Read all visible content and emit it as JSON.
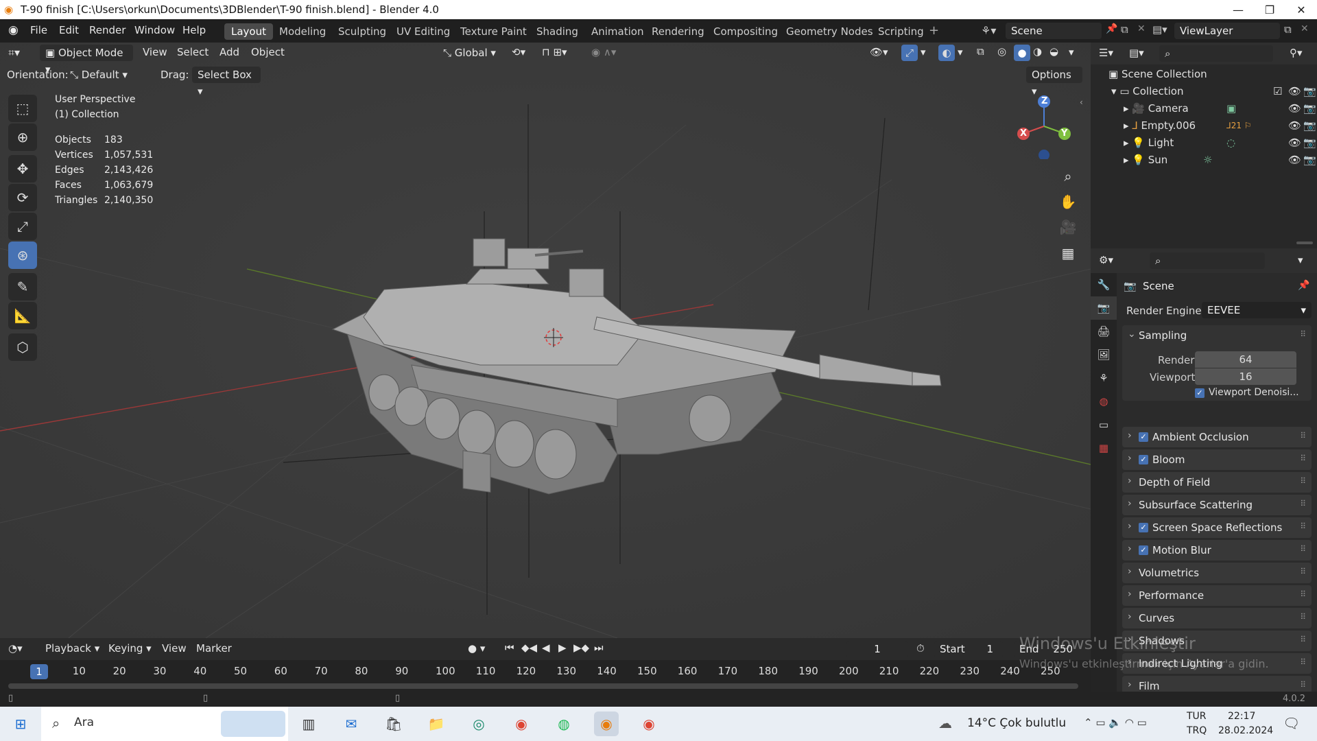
{
  "window": {
    "title": "T-90 finish [C:\\Users\\orkun\\Documents\\3DBlender\\T-90 finish.blend] - Blender 4.0",
    "minimize": "—",
    "maximize": "❐",
    "close": "✕"
  },
  "menu": {
    "items": [
      "File",
      "Edit",
      "Render",
      "Window",
      "Help"
    ],
    "workspaces": [
      "Layout",
      "Modeling",
      "Sculpting",
      "UV Editing",
      "Texture Paint",
      "Shading",
      "Animation",
      "Rendering",
      "Compositing",
      "Geometry Nodes",
      "Scripting"
    ],
    "active_workspace": "Layout",
    "add_workspace": "+",
    "scene": "Scene",
    "view_layer": "ViewLayer"
  },
  "viewport": {
    "mode": "Object Mode",
    "menus": [
      "View",
      "Select",
      "Add",
      "Object"
    ],
    "transform_orientation": "Global",
    "orientation_label": "Orientation:",
    "orientation_value": "Default",
    "drag_label": "Drag:",
    "drag_value": "Select Box",
    "options": "Options",
    "perspective": "User Perspective",
    "collection": "(1) Collection",
    "stats": [
      {
        "label": "Objects",
        "value": "183"
      },
      {
        "label": "Vertices",
        "value": "1,057,531"
      },
      {
        "label": "Edges",
        "value": "2,143,426"
      },
      {
        "label": "Faces",
        "value": "1,063,679"
      },
      {
        "label": "Triangles",
        "value": "2,140,350"
      }
    ],
    "gizmo": {
      "x": "X",
      "y": "Y",
      "z": "Z"
    }
  },
  "outliner": {
    "root": "Scene Collection",
    "collection": "Collection",
    "items": [
      {
        "name": "Camera"
      },
      {
        "name": "Empty.006",
        "badge": "21"
      },
      {
        "name": "Light"
      },
      {
        "name": "Sun"
      }
    ]
  },
  "properties": {
    "context": "Scene",
    "render_engine_label": "Render Engine",
    "render_engine": "EEVEE",
    "sampling": {
      "title": "Sampling",
      "render_label": "Render",
      "render_value": "64",
      "viewport_label": "Viewport",
      "viewport_value": "16",
      "denoise": "Viewport Denoisi..."
    },
    "panels": [
      {
        "label": "Ambient Occlusion",
        "checkbox": true
      },
      {
        "label": "Bloom",
        "checkbox": true
      },
      {
        "label": "Depth of Field",
        "checkbox": false
      },
      {
        "label": "Subsurface Scattering",
        "checkbox": false
      },
      {
        "label": "Screen Space Reflections",
        "checkbox": true
      },
      {
        "label": "Motion Blur",
        "checkbox": true
      },
      {
        "label": "Volumetrics",
        "checkbox": false
      },
      {
        "label": "Performance",
        "checkbox": false
      },
      {
        "label": "Curves",
        "checkbox": false
      },
      {
        "label": "Shadows",
        "checkbox": false
      },
      {
        "label": "Indirect Lighting",
        "checkbox": false
      },
      {
        "label": "Film",
        "checkbox": false
      }
    ]
  },
  "timeline": {
    "menus": [
      "Playback",
      "Keying",
      "View",
      "Marker"
    ],
    "current_frame": "1",
    "start_label": "Start",
    "start": "1",
    "end_label": "End",
    "end": "250",
    "ruler": [
      "1",
      "10",
      "20",
      "30",
      "40",
      "50",
      "60",
      "70",
      "80",
      "90",
      "100",
      "110",
      "120",
      "130",
      "140",
      "150",
      "160",
      "170",
      "180",
      "190",
      "200",
      "210",
      "220",
      "230",
      "240",
      "250"
    ]
  },
  "status": {
    "version": "4.0.2"
  },
  "watermark": {
    "line1": "Windows'u Etkinleştir",
    "line2": "Windows'u etkinleştirmek için Ayarlar'a gidin."
  },
  "taskbar": {
    "search": "Ara",
    "weather": "14°C  Çok bulutlu",
    "lang_top": "TUR",
    "lang_bottom": "TRQ",
    "time": "22:17",
    "date": "28.02.2024"
  }
}
